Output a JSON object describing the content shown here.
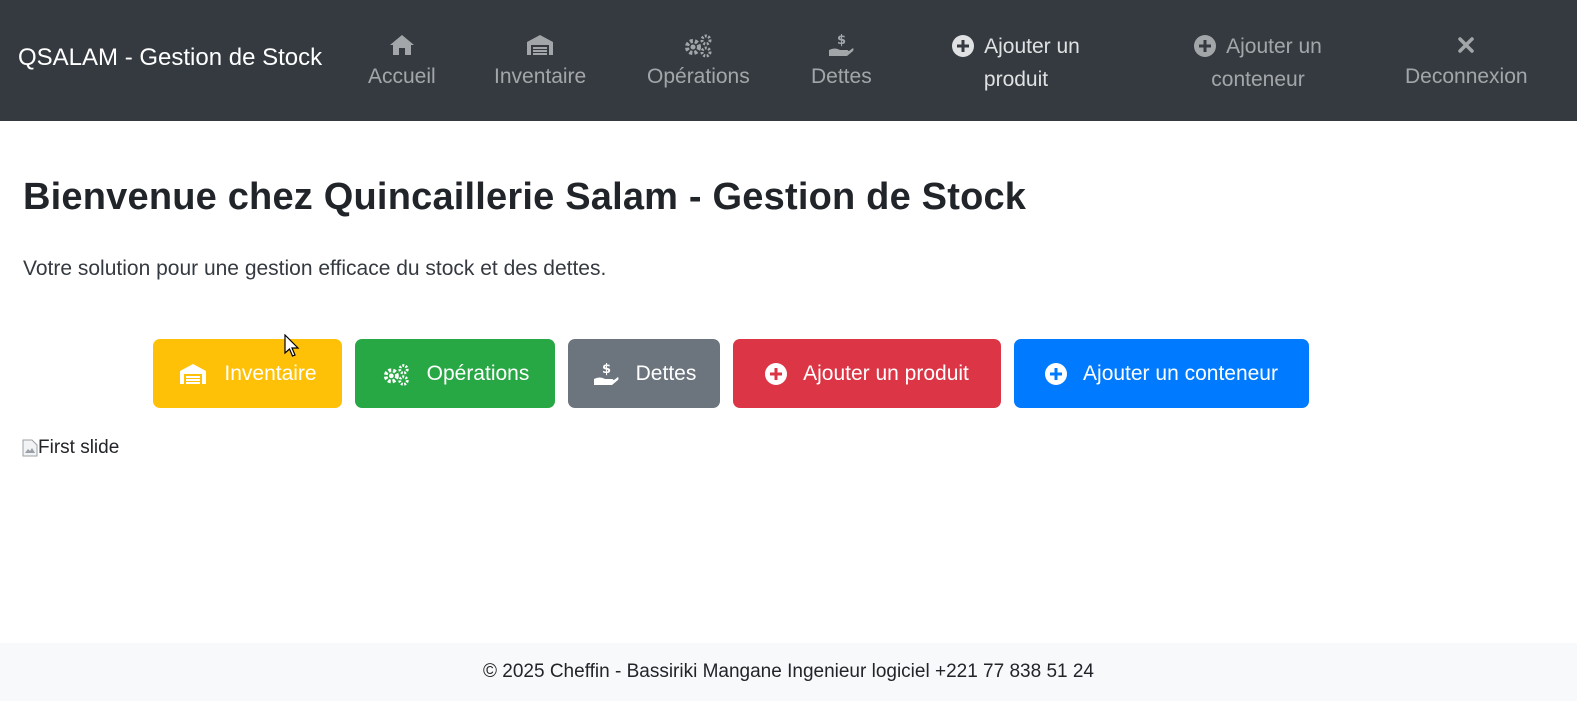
{
  "navbar": {
    "brand": "QSALAM - Gestion de Stock",
    "items": [
      {
        "label": "Accueil",
        "icon": "home-icon"
      },
      {
        "label": "Inventaire",
        "icon": "warehouse-icon"
      },
      {
        "label": "Opérations",
        "icon": "gears-icon"
      },
      {
        "label": "Dettes",
        "icon": "hand-dollar-icon"
      },
      {
        "label_line1": "Ajouter un",
        "label_line2": "produit",
        "icon": "plus-circle-icon"
      },
      {
        "label_line1": "Ajouter un",
        "label_line2": "conteneur",
        "icon": "plus-circle-icon"
      },
      {
        "label": "Deconnexion",
        "icon": "close-icon"
      }
    ]
  },
  "main": {
    "title": "Bienvenue chez Quincaillerie Salam - Gestion de Stock",
    "lead": "Votre solution pour une gestion efficace du stock et des dettes.",
    "buttons": [
      {
        "label": "Inventaire",
        "color": "#ffc107",
        "icon": "warehouse-icon"
      },
      {
        "label": "Opérations",
        "color": "#28a745",
        "icon": "gears-icon"
      },
      {
        "label": "Dettes",
        "color": "#6c757d",
        "icon": "hand-dollar-icon"
      },
      {
        "label": "Ajouter un produit",
        "color": "#dc3545",
        "icon": "plus-circle-icon"
      },
      {
        "label": "Ajouter un conteneur",
        "color": "#007bff",
        "icon": "plus-circle-icon"
      }
    ],
    "slide_alt": "First slide"
  },
  "footer": {
    "text": "© 2025 Cheffin - Bassiriki Mangane Ingenieur logiciel +221 77 838 51 24"
  },
  "colors": {
    "navbar_bg": "#343a40",
    "footer_bg": "#f8f9fa"
  }
}
